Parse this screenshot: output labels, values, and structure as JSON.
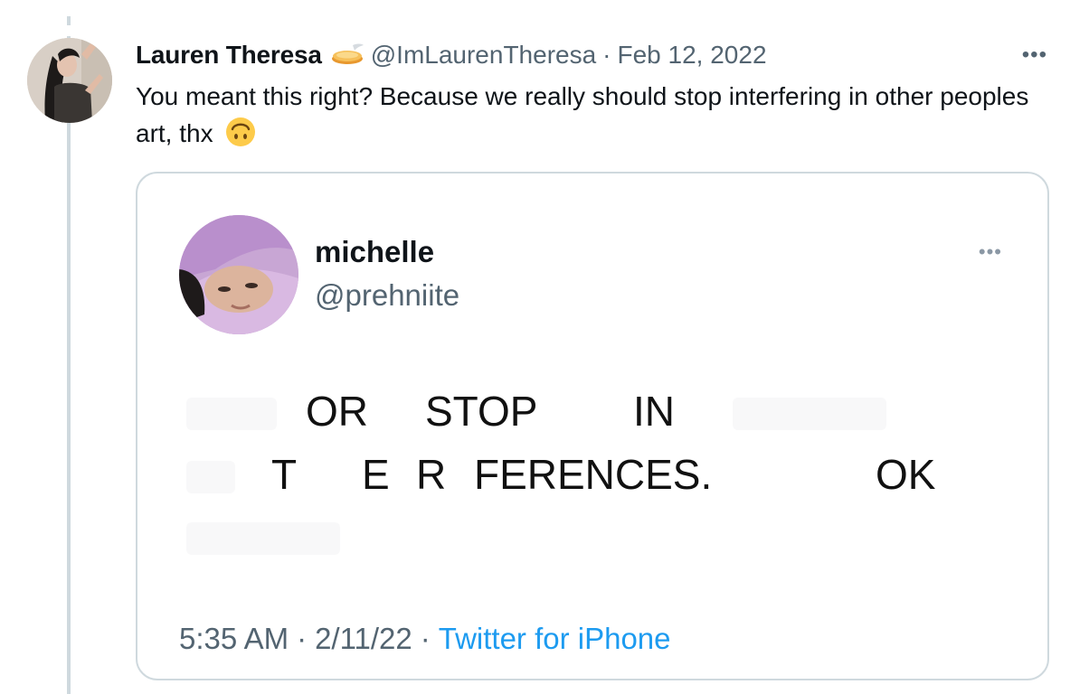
{
  "tweet": {
    "author_name": "Lauren Theresa",
    "handle": "@ImLaurenTheresa",
    "separator": "·",
    "date": "Feb 12, 2022",
    "more_label": "•••",
    "text": "You meant this right? Because we really should stop interfering in other peoples art, thx",
    "emoji_icon": "upside-down-face-emoji",
    "badge_icon": "pie-badge-icon"
  },
  "quote": {
    "author_name": "michelle",
    "handle": "@prehniite",
    "more_label": "•••",
    "body_words": [
      "OR",
      "STOP",
      "IN",
      "T",
      "E",
      "R",
      "FERENCES.",
      "OK"
    ],
    "time": "5:35 AM",
    "separator": "·",
    "date": "2/11/22",
    "source": "Twitter for iPhone"
  },
  "colors": {
    "text": "#0f1419",
    "muted": "#536471",
    "link": "#1d9bf0",
    "border": "#cfd9de"
  }
}
